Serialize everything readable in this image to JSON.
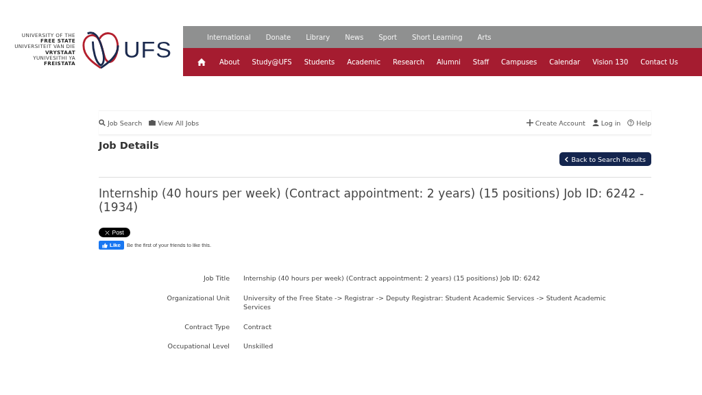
{
  "logo": {
    "lines": [
      {
        "text": "UNIVERSITY OF THE",
        "bold": false
      },
      {
        "text": "FREE STATE",
        "bold": true
      },
      {
        "text": "UNIVERSITEIT VAN DIE",
        "bold": false
      },
      {
        "text": "VRYSTAAT",
        "bold": true
      },
      {
        "text": "YUNIVESITHI YA",
        "bold": false
      },
      {
        "text": "FREISTATA",
        "bold": true
      }
    ],
    "wordmark": "UFS"
  },
  "top_nav": [
    "International",
    "Donate",
    "Library",
    "News",
    "Sport",
    "Short Learning",
    "Arts"
  ],
  "main_nav": [
    "About",
    "Study@UFS",
    "Students",
    "Academic",
    "Research",
    "Alumni",
    "Staff",
    "Campuses",
    "Calendar",
    "Vision 130",
    "Contact Us"
  ],
  "toolbar": {
    "left": [
      {
        "label": "Job Search",
        "kind": "search"
      },
      {
        "label": "View All Jobs",
        "kind": "briefcase"
      }
    ],
    "right": [
      {
        "label": "Create Account",
        "kind": "plus"
      },
      {
        "label": "Log in",
        "kind": "user"
      },
      {
        "label": "Help",
        "kind": "help"
      }
    ]
  },
  "page_title": "Job Details",
  "back_button": "Back to Search Results",
  "job_heading": "Internship (40 hours per week) (Contract appointment: 2 years) (15 positions) Job ID: 6242 - (1934)",
  "social": {
    "post": "Post",
    "like": "Like",
    "like_text": "Be the first of your friends to like this."
  },
  "details": [
    {
      "label": "Job Title",
      "value": "Internship (40 hours per week) (Contract appointment: 2 years) (15 positions) Job ID: 6242"
    },
    {
      "label": "Organizational Unit",
      "value": "University of the Free State -> Registrar -> Deputy Registrar: Student Academic Services -> Student Academic Services"
    },
    {
      "label": "Contract Type",
      "value": "Contract"
    },
    {
      "label": "Occupational Level",
      "value": "Unskilled"
    }
  ]
}
